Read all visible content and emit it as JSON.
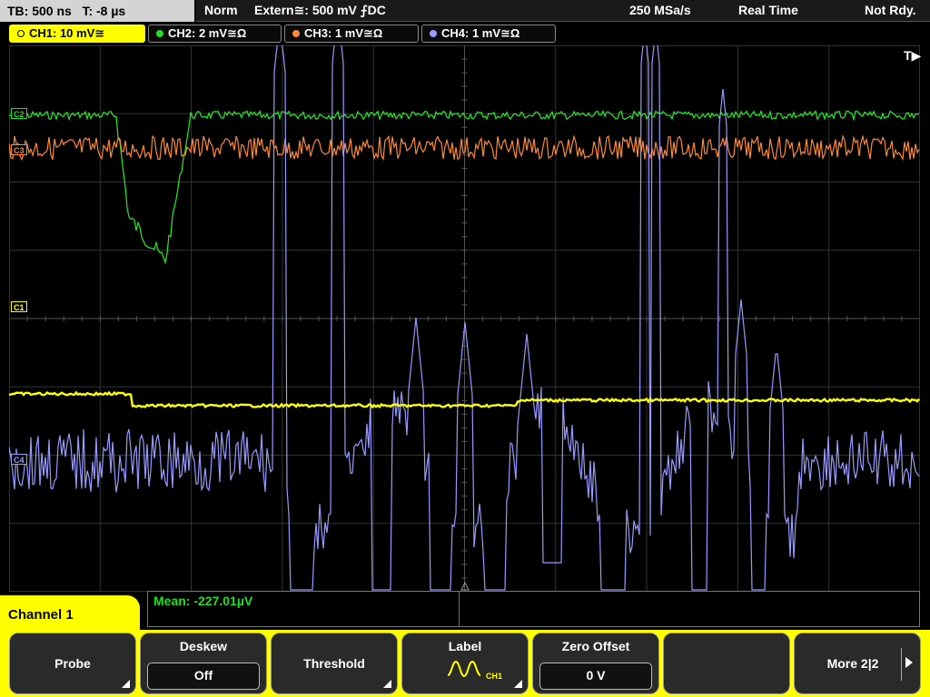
{
  "status": {
    "tb": "TB: 500 ns   T: -8 µs",
    "mode": "Norm",
    "trigger": "Extern≅: 500 mV ⨍DC",
    "sample_rate": "250 MSa/s",
    "acquisition": "Real Time",
    "state": "Not Rdy."
  },
  "channels": [
    {
      "label": "CH1: 10 mV≅",
      "color": "#ffff00",
      "active": true
    },
    {
      "label": "CH2: 2 mV≅Ω",
      "color": "#22dd22",
      "active": false
    },
    {
      "label": "CH3: 1 mV≅Ω",
      "color": "#ff8833",
      "active": false
    },
    {
      "label": "CH4: 1 mV≅Ω",
      "color": "#9999ff",
      "active": false
    }
  ],
  "markers": {
    "c1": "C1",
    "c2": "C2",
    "c3": "C3",
    "c4": "C4",
    "trigger_pos": "T▶"
  },
  "measurement": {
    "mean": "Mean: -227.01µV"
  },
  "menu": {
    "title": "Channel 1",
    "softkeys": [
      {
        "label": "Probe"
      },
      {
        "label": "Deskew",
        "value": "Off"
      },
      {
        "label": "Threshold"
      },
      {
        "label": "Label",
        "value": "CH1"
      },
      {
        "label": "Zero Offset",
        "value": "0 V"
      },
      {
        "label": ""
      },
      {
        "label": "More 2|2"
      }
    ]
  }
}
